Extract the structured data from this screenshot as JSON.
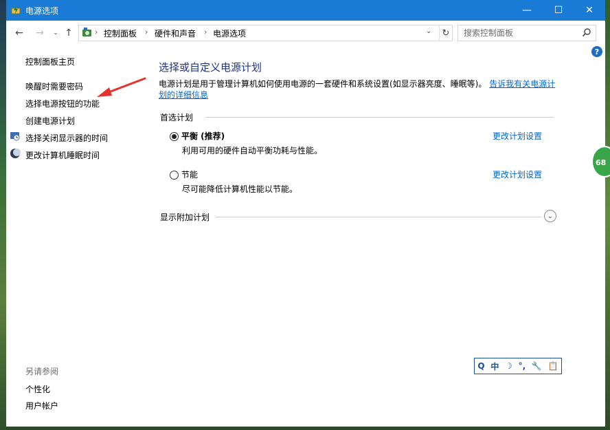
{
  "window": {
    "title": "电源选项",
    "minimize_label": "—",
    "maximize_label": "☐",
    "close_label": "✕"
  },
  "address": {
    "crumbs": [
      "控制面板",
      "硬件和声音",
      "电源选项"
    ],
    "search_placeholder": "搜索控制面板"
  },
  "sidebar": {
    "home": "控制面板主页",
    "items": [
      {
        "label": "唤醒时需要密码"
      },
      {
        "label": "选择电源按钮的功能"
      },
      {
        "label": "创建电源计划"
      },
      {
        "label": "选择关闭显示器的时间"
      },
      {
        "label": "更改计算机睡眠时间"
      }
    ],
    "see_also_title": "另请参阅",
    "see_also": [
      "个性化",
      "用户帐户"
    ]
  },
  "main": {
    "title": "选择或自定义电源计划",
    "description": "电源计划是用于管理计算机如何使用电源的一套硬件和系统设置(如显示器亮度、睡眠等)。",
    "description_link": "告诉我有关电源计划的详细信息",
    "preferred_label": "首选计划",
    "plans": [
      {
        "name": "平衡 (推荐)",
        "desc": "利用可用的硬件自动平衡功耗与性能。",
        "link": "更改计划设置",
        "checked": true
      },
      {
        "name": "节能",
        "desc": "尽可能降低计算机性能以节能。",
        "link": "更改计划设置",
        "checked": false
      }
    ],
    "more_plans_label": "显示附加计划"
  },
  "ime": {
    "items": [
      "Q",
      "中",
      "☽",
      "°,",
      "🔧",
      "📋"
    ]
  },
  "badge": {
    "value": "68"
  },
  "colors": {
    "titlebar": "#1a7bd7",
    "heading": "#1e3287",
    "link": "#0066cc",
    "arrow": "#e8322c"
  }
}
